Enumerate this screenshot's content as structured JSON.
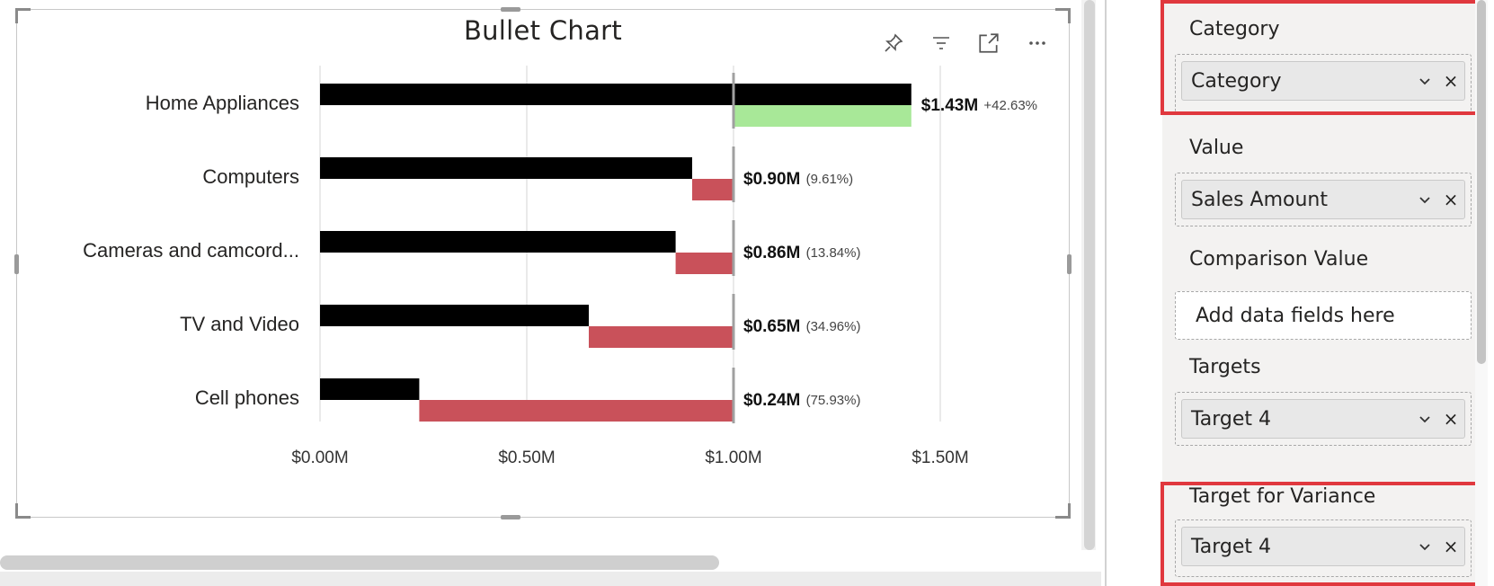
{
  "visual": {
    "title": "Bullet Chart",
    "header_icons": [
      "pin-icon",
      "filter-icon",
      "focus-mode-icon",
      "more-options-icon"
    ]
  },
  "chart_data": {
    "type": "bar",
    "subtype": "bullet",
    "title": "Bullet Chart",
    "categories": [
      "Home Appliances",
      "Computers",
      "Cameras and camcord...",
      "TV and Video",
      "Cell phones"
    ],
    "values": [
      1.43,
      0.9,
      0.86,
      0.65,
      0.24
    ],
    "value_labels": [
      "$1.43M",
      "$0.90M",
      "$0.86M",
      "$0.65M",
      "$0.24M"
    ],
    "variance_labels": [
      "+42.63%",
      "(9.61%)",
      "(13.84%)",
      "(34.96%)",
      "(75.93%)"
    ],
    "target": 1.0,
    "x_ticks": [
      0,
      0.5,
      1.0,
      1.5
    ],
    "x_tick_labels": [
      "$0.00M",
      "$0.50M",
      "$1.00M",
      "$1.50M"
    ],
    "xlim": [
      0,
      1.75
    ],
    "grid": true,
    "colors": {
      "value_bar": "#000000",
      "positive_variance": "#a8e898",
      "negative_variance": "#c9515a",
      "target_line": "#a0a0a0",
      "grid": "#e4e4e4"
    }
  },
  "fields_pane": {
    "wells": [
      {
        "title": "Category",
        "field": "Category",
        "highlighted": true
      },
      {
        "title": "Value",
        "field": "Sales Amount",
        "highlighted": false
      },
      {
        "title": "Comparison Value",
        "placeholder": "Add data fields here",
        "highlighted": false
      },
      {
        "title": "Targets",
        "field": "Target 4",
        "highlighted": false
      },
      {
        "title": "Target for Variance",
        "field": "Target 4",
        "highlighted": true
      }
    ],
    "highlight_color": "#e0383e"
  }
}
